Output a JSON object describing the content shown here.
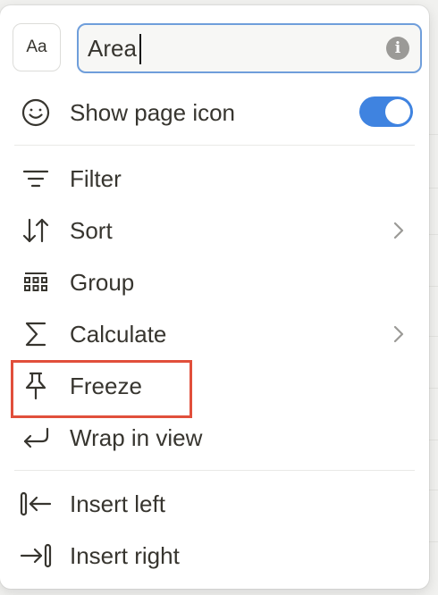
{
  "menu": {
    "type_button_label": "Aa",
    "name_input": {
      "value": "Area",
      "placeholder": ""
    },
    "info_icon_glyph": "i",
    "show_page_icon": {
      "label": "Show page icon",
      "enabled": true
    },
    "items": [
      {
        "label": "Filter",
        "icon": "filter-icon",
        "submenu": false
      },
      {
        "label": "Sort",
        "icon": "sort-arrows-icon",
        "submenu": true
      },
      {
        "label": "Group",
        "icon": "group-grid-icon",
        "submenu": false
      },
      {
        "label": "Calculate",
        "icon": "sigma-icon",
        "submenu": true
      },
      {
        "label": "Freeze",
        "icon": "pin-icon",
        "submenu": false,
        "highlighted": true
      },
      {
        "label": "Wrap in view",
        "icon": "wrap-arrow-icon",
        "submenu": false
      }
    ],
    "insert_items": [
      {
        "label": "Insert left",
        "icon": "insert-left-icon"
      },
      {
        "label": "Insert right",
        "icon": "insert-right-icon"
      }
    ]
  },
  "colors": {
    "accent": "#3f83e0",
    "input_border": "#6f9edb",
    "highlight": "#e14f3b",
    "text": "#37352f"
  }
}
